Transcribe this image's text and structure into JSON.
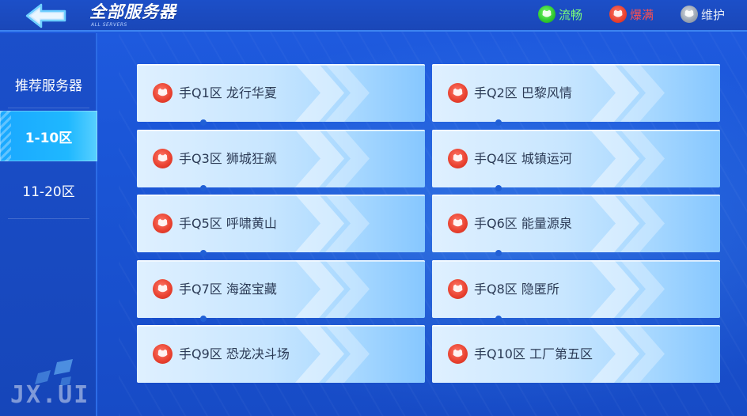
{
  "header": {
    "title": "全部服务器",
    "subtitle": "ALL SERVERS",
    "legend": [
      {
        "label": "流畅",
        "status": "smooth",
        "color": "#3ad13a",
        "icon": "smooth-status-icon"
      },
      {
        "label": "爆满",
        "status": "full",
        "color": "#e8402e",
        "icon": "full-status-icon"
      },
      {
        "label": "维护",
        "status": "maintenance",
        "color": "#9aa4b2",
        "icon": "maintenance-status-icon"
      }
    ]
  },
  "sidebar": {
    "items": [
      {
        "label": "推荐服务器",
        "active": false
      },
      {
        "label": "1-10区",
        "active": true
      },
      {
        "label": "11-20区",
        "active": false
      }
    ]
  },
  "servers": [
    {
      "label": "手Q1区 龙行华夏",
      "status": "full"
    },
    {
      "label": "手Q2区 巴黎风情",
      "status": "full"
    },
    {
      "label": "手Q3区 狮城狂飙",
      "status": "full"
    },
    {
      "label": "手Q4区 城镇运河",
      "status": "full"
    },
    {
      "label": "手Q5区 呼啸黄山",
      "status": "full"
    },
    {
      "label": "手Q6区 能量源泉",
      "status": "full"
    },
    {
      "label": "手Q7区 海盗宝藏",
      "status": "full"
    },
    {
      "label": "手Q8区 隐匿所",
      "status": "full"
    },
    {
      "label": "手Q9区 恐龙决斗场",
      "status": "full"
    },
    {
      "label": "手Q10区 工厂第五区",
      "status": "full"
    }
  ],
  "watermark": "JX.UI",
  "colors": {
    "accent": "#1fb8ff",
    "background": "#1a55d6",
    "full": "#e8402e",
    "smooth": "#3ad13a",
    "maintenance": "#9aa4b2"
  }
}
